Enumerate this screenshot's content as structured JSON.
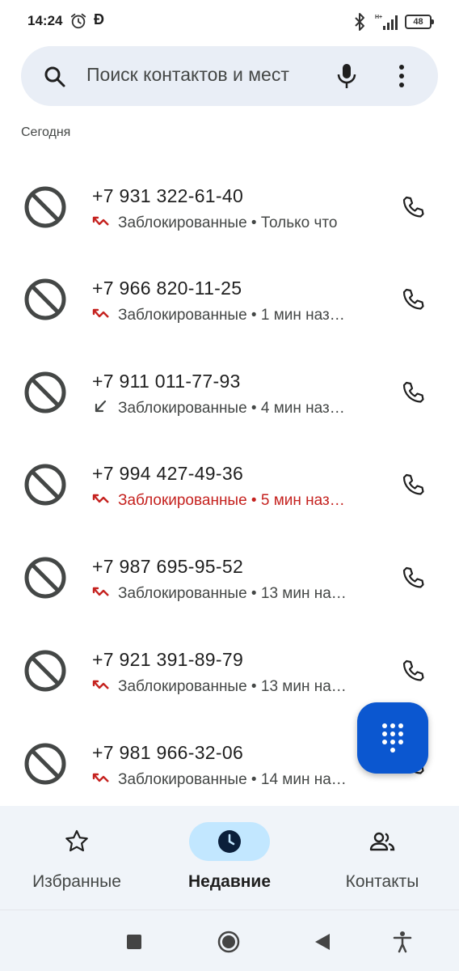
{
  "status_bar": {
    "time": "14:24",
    "letter_icon": "Ð",
    "battery": "48",
    "network": "H+"
  },
  "search": {
    "placeholder": "Поиск контактов и мест"
  },
  "section_label": "Сегодня",
  "calls": [
    {
      "number": "+7 931 322-61-40",
      "status": "Заблокированные",
      "time": "Только что",
      "direction": "missed",
      "highlight": false
    },
    {
      "number": "+7 966 820-11-25",
      "status": "Заблокированные",
      "time": "1 мин наз…",
      "direction": "missed",
      "highlight": false
    },
    {
      "number": "+7 911 011-77-93",
      "status": "Заблокированные",
      "time": "4 мин наз…",
      "direction": "incoming",
      "highlight": false
    },
    {
      "number": "+7 994 427-49-36",
      "status": "Заблокированные",
      "time": "5 мин наз…",
      "direction": "missed",
      "highlight": true
    },
    {
      "number": "+7 987 695-95-52",
      "status": "Заблокированные",
      "time": "13 мин на…",
      "direction": "missed",
      "highlight": false
    },
    {
      "number": "+7 921 391-89-79",
      "status": "Заблокированные",
      "time": "13 мин на…",
      "direction": "missed",
      "highlight": false
    },
    {
      "number": "+7 981 966-32-06",
      "status": "Заблокированные",
      "time": "14 мин на…",
      "direction": "missed",
      "highlight": false
    }
  ],
  "bottom_nav": [
    {
      "label": "Избранные",
      "icon": "star-icon",
      "active": false
    },
    {
      "label": "Недавние",
      "icon": "clock-icon",
      "active": true
    },
    {
      "label": "Контакты",
      "icon": "people-icon",
      "active": false
    }
  ],
  "colors": {
    "accent": "#0b57d0",
    "missed_red": "#c5221f",
    "search_bg": "#e9eef6",
    "nav_active_bg": "#c2e7ff",
    "nav_bg": "#f0f4f9"
  }
}
